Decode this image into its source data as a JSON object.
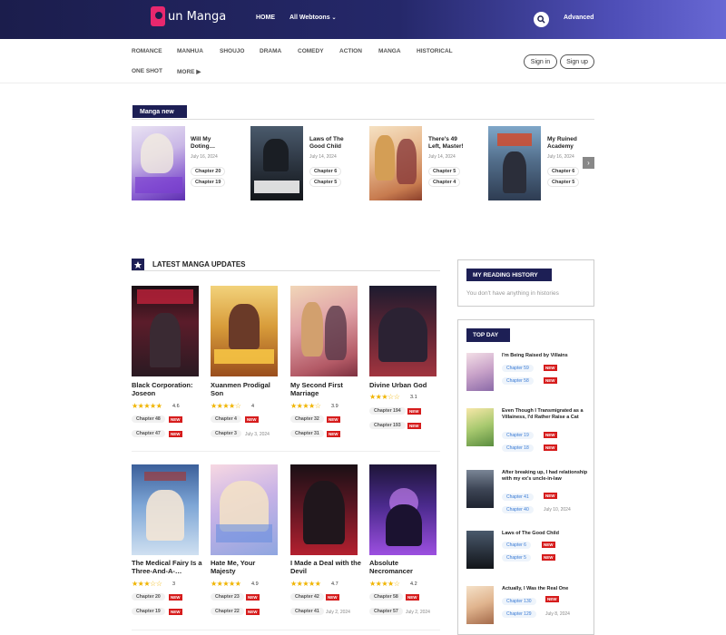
{
  "header": {
    "logo_text": "un Manga",
    "nav_home": "HOME",
    "nav_webtoons": "All Webtoons",
    "advanced": "Advanced"
  },
  "genres": [
    "ROMANCE",
    "MANHUA",
    "SHOUJO",
    "DRAMA",
    "COMEDY",
    "ACTION",
    "MANGA",
    "HISTORICAL",
    "ONE SHOT",
    "MORE"
  ],
  "auth": {
    "signin": "Sign in",
    "signup": "Sign up"
  },
  "manga_new": {
    "title": "Manga new",
    "items": [
      {
        "title": "Will My Doting…",
        "date": "July 16, 2024",
        "chapters": [
          "Chapter 20",
          "Chapter 19"
        ]
      },
      {
        "title": "Laws of The Good Child",
        "date": "July 14, 2024",
        "chapters": [
          "Chapter 6",
          "Chapter 5"
        ]
      },
      {
        "title": "There's 49 Left, Master!",
        "date": "July 14, 2024",
        "chapters": [
          "Chapter 5",
          "Chapter 4"
        ]
      },
      {
        "title": "My Ruined Academy",
        "date": "July 16, 2024",
        "chapters": [
          "Chapter 6",
          "Chapter 5"
        ]
      }
    ]
  },
  "latest": {
    "title": "LATEST MANGA UPDATES",
    "items": [
      {
        "title": "Black Corporation: Joseon",
        "rating": "4.6",
        "stars": "★★★★★",
        "chapters": [
          {
            "label": "Chapter 48",
            "new": "NEW",
            "date": ""
          },
          {
            "label": "Chapter 47",
            "new": "NEW",
            "date": ""
          }
        ]
      },
      {
        "title": "Xuanmen Prodigal Son",
        "rating": "4",
        "stars": "★★★★☆",
        "chapters": [
          {
            "label": "Chapter 4",
            "new": "NEW",
            "date": ""
          },
          {
            "label": "Chapter 3",
            "new": "",
            "date": "July 3, 2024"
          }
        ]
      },
      {
        "title": "My Second First Marriage",
        "rating": "3.9",
        "stars": "★★★★☆",
        "chapters": [
          {
            "label": "Chapter 32",
            "new": "NEW",
            "date": ""
          },
          {
            "label": "Chapter 31",
            "new": "NEW",
            "date": ""
          }
        ]
      },
      {
        "title": "Divine Urban God",
        "rating": "3.1",
        "stars": "★★★☆☆",
        "chapters": [
          {
            "label": "Chapter 194",
            "new": "NEW",
            "date": ""
          },
          {
            "label": "Chapter 193",
            "new": "NEW",
            "date": ""
          }
        ]
      },
      {
        "title": "The Medical Fairy Is a Three-And-A-…",
        "rating": "3",
        "stars": "★★★☆☆",
        "chapters": [
          {
            "label": "Chapter 20",
            "new": "NEW",
            "date": ""
          },
          {
            "label": "Chapter 19",
            "new": "NEW",
            "date": ""
          }
        ]
      },
      {
        "title": "Hate Me, Your Majesty",
        "rating": "4.9",
        "stars": "★★★★★",
        "chapters": [
          {
            "label": "Chapter 23",
            "new": "NEW",
            "date": ""
          },
          {
            "label": "Chapter 22",
            "new": "NEW",
            "date": ""
          }
        ]
      },
      {
        "title": "I Made a Deal with the Devil",
        "rating": "4.7",
        "stars": "★★★★★",
        "chapters": [
          {
            "label": "Chapter 42",
            "new": "NEW",
            "date": ""
          },
          {
            "label": "Chapter 41",
            "new": "",
            "date": "July 2, 2024"
          }
        ]
      },
      {
        "title": "Absolute Necromancer",
        "rating": "4.2",
        "stars": "★★★★☆",
        "chapters": [
          {
            "label": "Chapter 58",
            "new": "NEW",
            "date": ""
          },
          {
            "label": "Chapter 57",
            "new": "",
            "date": "July 2, 2024"
          }
        ]
      }
    ]
  },
  "history": {
    "title": "MY READING HISTORY",
    "empty": "You don't have anything in histories"
  },
  "top_day": {
    "title": "TOP DAY",
    "items": [
      {
        "title": "I'm Being Raised by Villains",
        "chapters": [
          {
            "label": "Chapter 59",
            "new": "NEW",
            "date": ""
          },
          {
            "label": "Chapter 58",
            "new": "NEW",
            "date": ""
          }
        ]
      },
      {
        "title": "Even Though I Transmigrated as a Villainess, I'd Rather Raise a Cat",
        "chapters": [
          {
            "label": "Chapter 19",
            "new": "NEW",
            "date": ""
          },
          {
            "label": "Chapter 18",
            "new": "NEW",
            "date": ""
          }
        ]
      },
      {
        "title": "After breaking up, I had relationship with my ex's uncle-in-law",
        "chapters": [
          {
            "label": "Chapter 41",
            "new": "NEW",
            "date": ""
          },
          {
            "label": "Chapter 40",
            "new": "",
            "date": "July 10, 2024"
          }
        ]
      },
      {
        "title": "Laws of The Good Child",
        "chapters": [
          {
            "label": "Chapter 6",
            "new": "NEW",
            "date": ""
          },
          {
            "label": "Chapter 5",
            "new": "NEW",
            "date": ""
          }
        ]
      },
      {
        "title": "Actually, I Was the Real One",
        "chapters": [
          {
            "label": "Chapter 130",
            "new": "NEW",
            "date": ""
          },
          {
            "label": "Chapter 129",
            "new": "",
            "date": "July 8, 2024"
          }
        ]
      }
    ]
  },
  "colors": {
    "brand_navy": "#1d1f55",
    "new_badge": "#d61c1c",
    "star": "#f0b400"
  }
}
